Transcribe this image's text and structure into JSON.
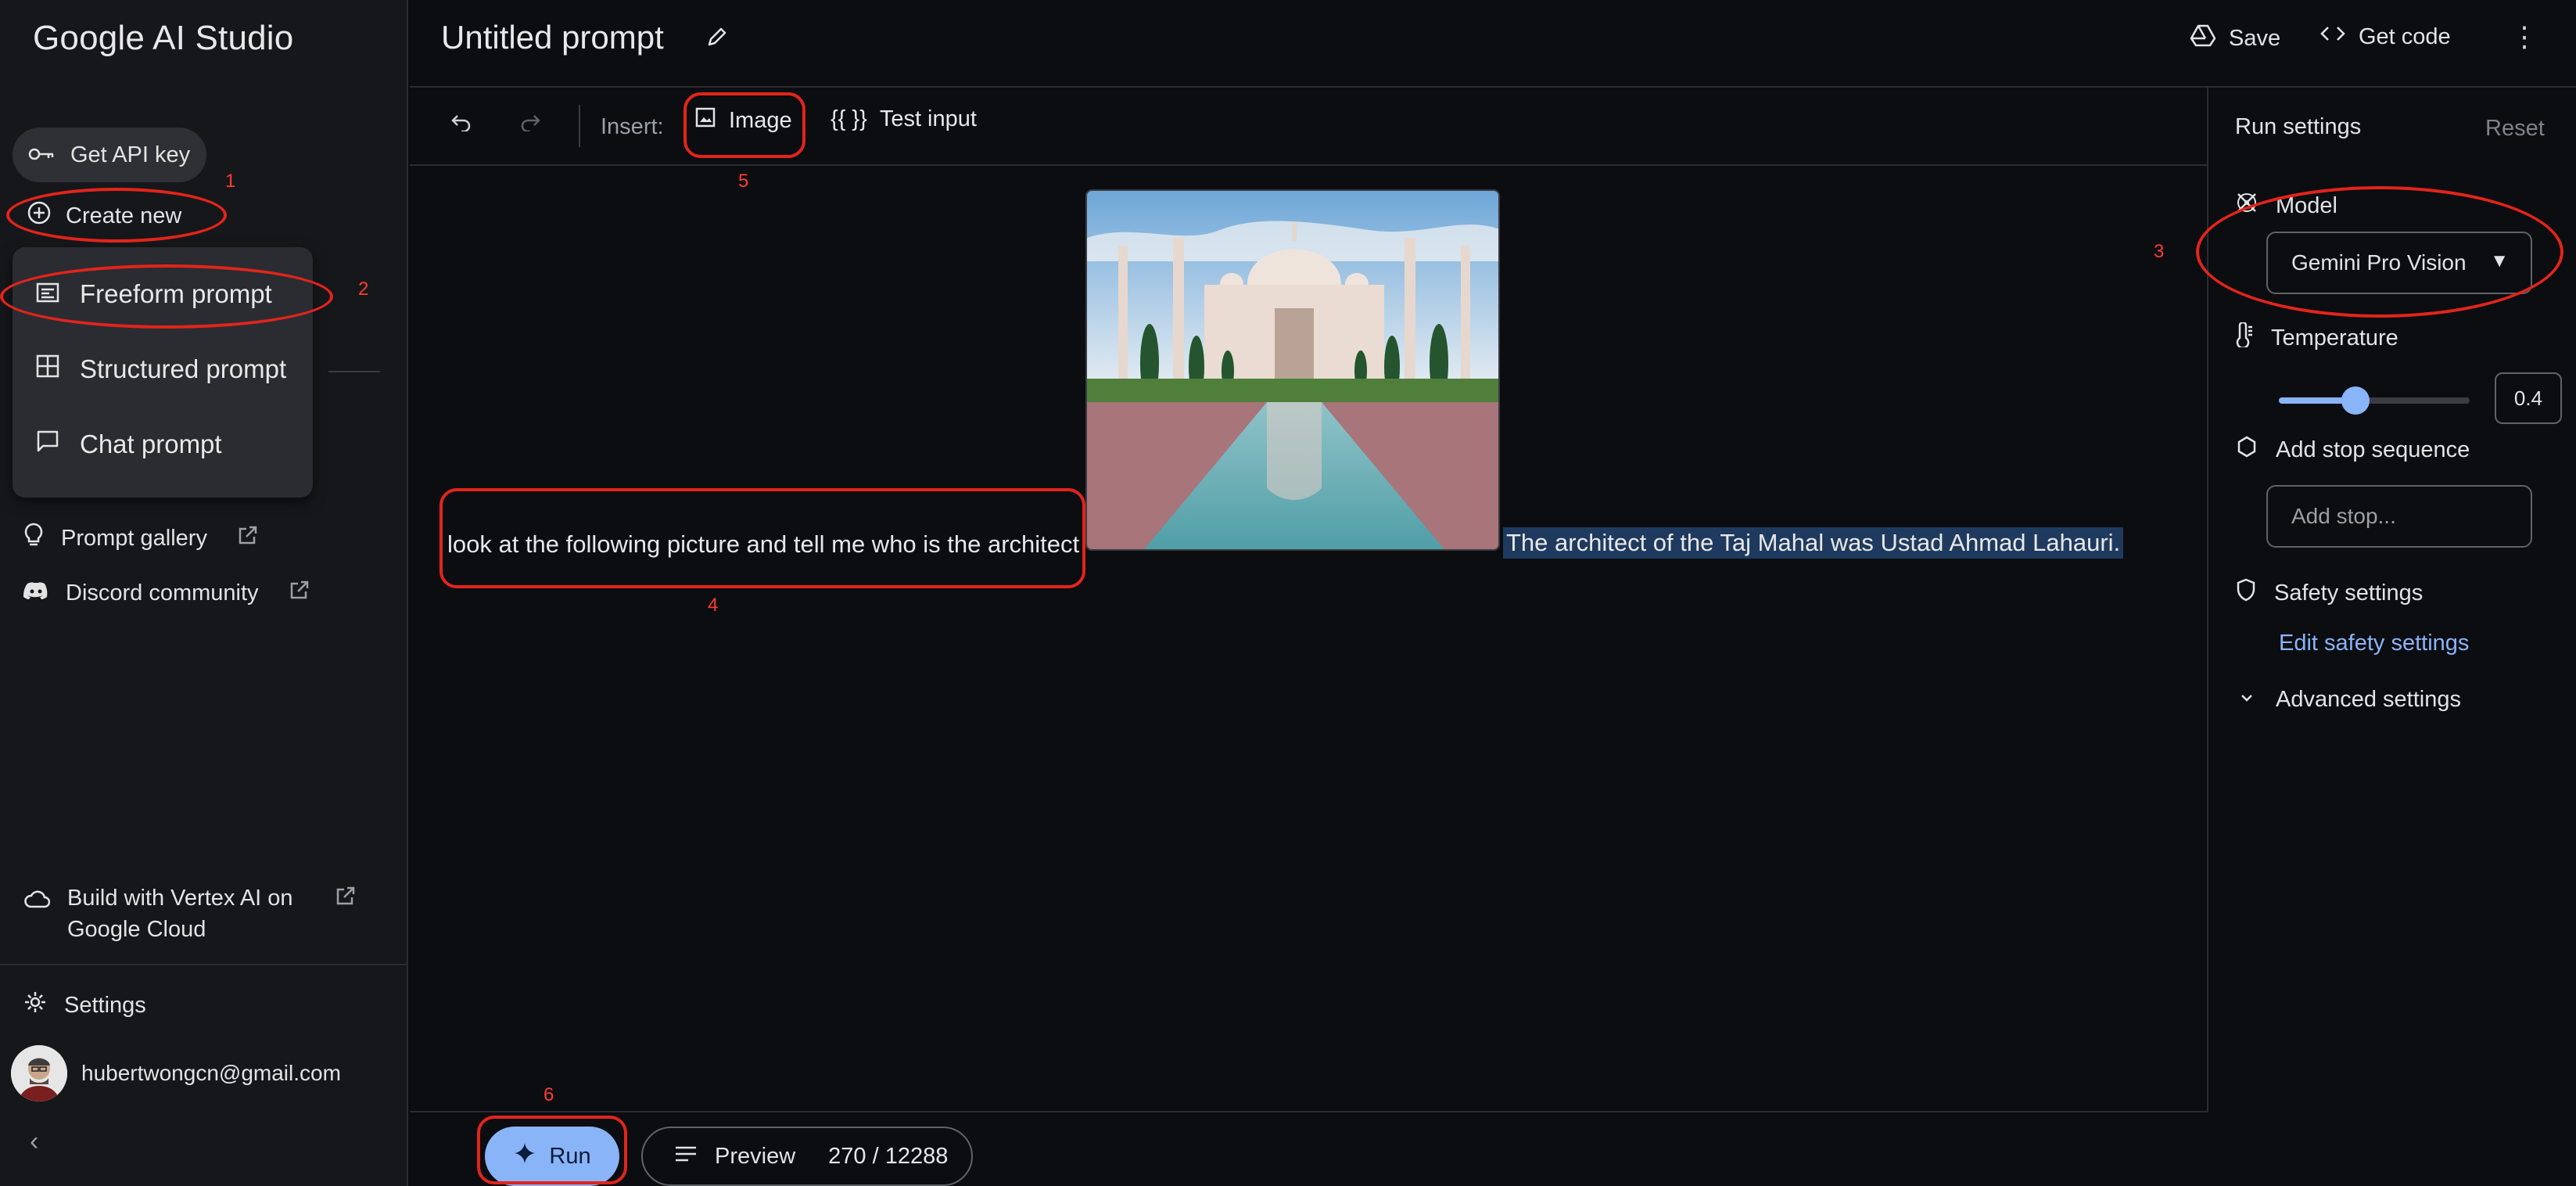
{
  "app": {
    "brand": "Google AI Studio"
  },
  "sidebar": {
    "get_api_key": "Get API key",
    "create_new": "Create new",
    "menu": [
      "Freeform prompt",
      "Structured prompt",
      "Chat prompt"
    ],
    "prompt_gallery": "Prompt gallery",
    "discord": "Discord community",
    "vertex": "Build with Vertex AI on Google Cloud",
    "settings": "Settings",
    "user_email": "hubertwongcn@gmail.com"
  },
  "header": {
    "title": "Untitled prompt",
    "save": "Save",
    "get_code": "Get code"
  },
  "toolbar": {
    "insert_label": "Insert:",
    "image": "Image",
    "test_input": "Test input",
    "braces": "{{ }}"
  },
  "canvas": {
    "prompt": "look at the following picture and tell me who is the architect",
    "answer": "The architect of the Taj Mahal was Ustad Ahmad Lahauri."
  },
  "run_settings": {
    "title": "Run settings",
    "reset": "Reset",
    "model_label": "Model",
    "model_value": "Gemini Pro Vision",
    "temperature_label": "Temperature",
    "temperature_value": "0.4",
    "temperature_fraction": 0.4,
    "stop_label": "Add stop sequence",
    "stop_placeholder": "Add stop...",
    "safety_label": "Safety settings",
    "edit_safety": "Edit safety settings",
    "advanced": "Advanced settings"
  },
  "bottom": {
    "run": "Run",
    "preview": "Preview",
    "token_count": "270 / 12288"
  },
  "annotations": [
    "1",
    "2",
    "3",
    "4",
    "5",
    "6"
  ],
  "colors": {
    "accent": "#8ab4f8",
    "annotation": "#e3241b",
    "background": "#0b0d11"
  }
}
